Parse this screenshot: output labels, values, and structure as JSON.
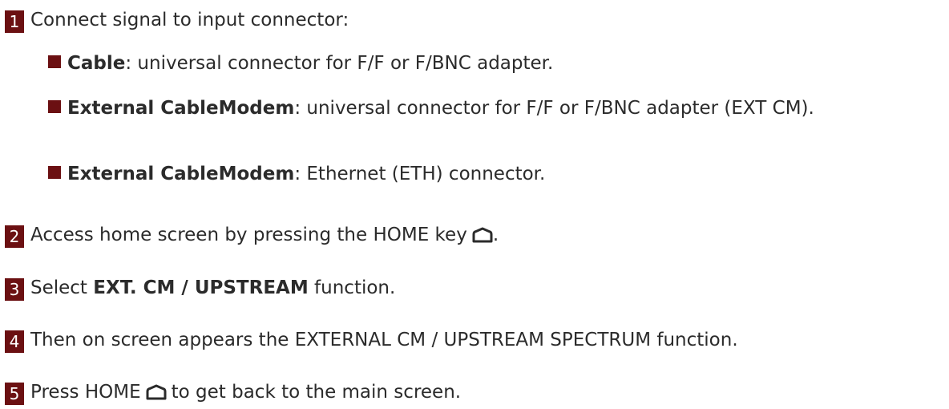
{
  "steps": [
    {
      "num": "1",
      "text": "Connect signal to input connector:"
    },
    {
      "num": "2",
      "text": "Access home screen by pressing the HOME key",
      "icon": "home-key-icon",
      "after": "."
    },
    {
      "num": "3",
      "pre": "Select ",
      "bold": "EXT. CM / UPSTREAM",
      "post": " function."
    },
    {
      "num": "4",
      "text": "Then on screen appears the EXTERNAL CM / UPSTREAM SPECTRUM function."
    },
    {
      "num": "5",
      "pre": "Press HOME",
      "icon": "home-key-icon",
      "post": "to get back to the main screen."
    }
  ],
  "bullets": [
    {
      "bold": "Cable",
      "text": ": universal connector for F/F or F/BNC adapter."
    },
    {
      "bold": "External CableModem",
      "text": ": universal connector for F/F or F/BNC adapter (EXT CM)."
    },
    {
      "bold": "External CableModem",
      "text": ": Ethernet (ETH) connector."
    }
  ],
  "colors": {
    "accent": "#6b1012",
    "text": "#2b2b2b"
  }
}
